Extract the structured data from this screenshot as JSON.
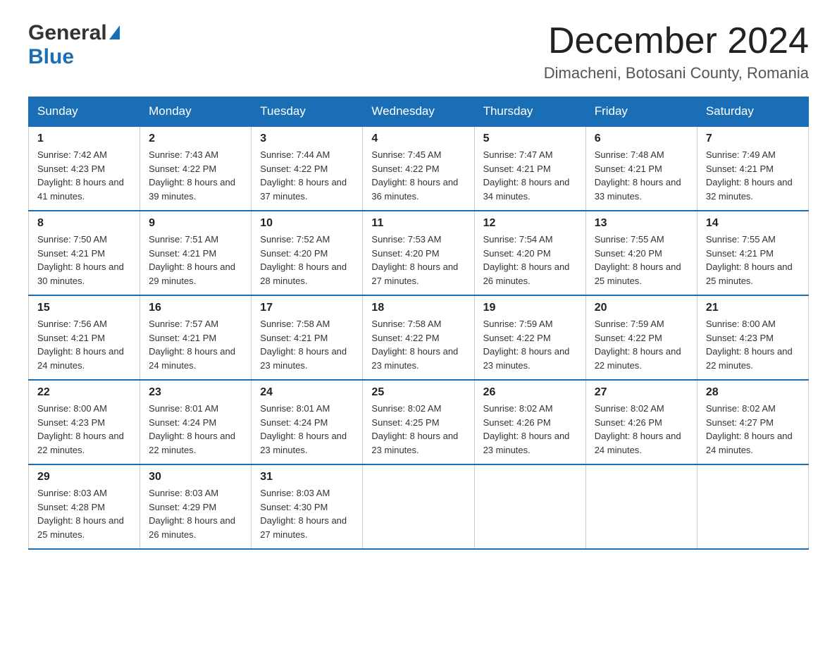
{
  "header": {
    "logo_general": "General",
    "logo_blue": "Blue",
    "month_title": "December 2024",
    "location": "Dimacheni, Botosani County, Romania"
  },
  "days_of_week": [
    "Sunday",
    "Monday",
    "Tuesday",
    "Wednesday",
    "Thursday",
    "Friday",
    "Saturday"
  ],
  "weeks": [
    [
      {
        "day": "1",
        "sunrise": "7:42 AM",
        "sunset": "4:23 PM",
        "daylight": "8 hours and 41 minutes."
      },
      {
        "day": "2",
        "sunrise": "7:43 AM",
        "sunset": "4:22 PM",
        "daylight": "8 hours and 39 minutes."
      },
      {
        "day": "3",
        "sunrise": "7:44 AM",
        "sunset": "4:22 PM",
        "daylight": "8 hours and 37 minutes."
      },
      {
        "day": "4",
        "sunrise": "7:45 AM",
        "sunset": "4:22 PM",
        "daylight": "8 hours and 36 minutes."
      },
      {
        "day": "5",
        "sunrise": "7:47 AM",
        "sunset": "4:21 PM",
        "daylight": "8 hours and 34 minutes."
      },
      {
        "day": "6",
        "sunrise": "7:48 AM",
        "sunset": "4:21 PM",
        "daylight": "8 hours and 33 minutes."
      },
      {
        "day": "7",
        "sunrise": "7:49 AM",
        "sunset": "4:21 PM",
        "daylight": "8 hours and 32 minutes."
      }
    ],
    [
      {
        "day": "8",
        "sunrise": "7:50 AM",
        "sunset": "4:21 PM",
        "daylight": "8 hours and 30 minutes."
      },
      {
        "day": "9",
        "sunrise": "7:51 AM",
        "sunset": "4:21 PM",
        "daylight": "8 hours and 29 minutes."
      },
      {
        "day": "10",
        "sunrise": "7:52 AM",
        "sunset": "4:20 PM",
        "daylight": "8 hours and 28 minutes."
      },
      {
        "day": "11",
        "sunrise": "7:53 AM",
        "sunset": "4:20 PM",
        "daylight": "8 hours and 27 minutes."
      },
      {
        "day": "12",
        "sunrise": "7:54 AM",
        "sunset": "4:20 PM",
        "daylight": "8 hours and 26 minutes."
      },
      {
        "day": "13",
        "sunrise": "7:55 AM",
        "sunset": "4:20 PM",
        "daylight": "8 hours and 25 minutes."
      },
      {
        "day": "14",
        "sunrise": "7:55 AM",
        "sunset": "4:21 PM",
        "daylight": "8 hours and 25 minutes."
      }
    ],
    [
      {
        "day": "15",
        "sunrise": "7:56 AM",
        "sunset": "4:21 PM",
        "daylight": "8 hours and 24 minutes."
      },
      {
        "day": "16",
        "sunrise": "7:57 AM",
        "sunset": "4:21 PM",
        "daylight": "8 hours and 24 minutes."
      },
      {
        "day": "17",
        "sunrise": "7:58 AM",
        "sunset": "4:21 PM",
        "daylight": "8 hours and 23 minutes."
      },
      {
        "day": "18",
        "sunrise": "7:58 AM",
        "sunset": "4:22 PM",
        "daylight": "8 hours and 23 minutes."
      },
      {
        "day": "19",
        "sunrise": "7:59 AM",
        "sunset": "4:22 PM",
        "daylight": "8 hours and 23 minutes."
      },
      {
        "day": "20",
        "sunrise": "7:59 AM",
        "sunset": "4:22 PM",
        "daylight": "8 hours and 22 minutes."
      },
      {
        "day": "21",
        "sunrise": "8:00 AM",
        "sunset": "4:23 PM",
        "daylight": "8 hours and 22 minutes."
      }
    ],
    [
      {
        "day": "22",
        "sunrise": "8:00 AM",
        "sunset": "4:23 PM",
        "daylight": "8 hours and 22 minutes."
      },
      {
        "day": "23",
        "sunrise": "8:01 AM",
        "sunset": "4:24 PM",
        "daylight": "8 hours and 22 minutes."
      },
      {
        "day": "24",
        "sunrise": "8:01 AM",
        "sunset": "4:24 PM",
        "daylight": "8 hours and 23 minutes."
      },
      {
        "day": "25",
        "sunrise": "8:02 AM",
        "sunset": "4:25 PM",
        "daylight": "8 hours and 23 minutes."
      },
      {
        "day": "26",
        "sunrise": "8:02 AM",
        "sunset": "4:26 PM",
        "daylight": "8 hours and 23 minutes."
      },
      {
        "day": "27",
        "sunrise": "8:02 AM",
        "sunset": "4:26 PM",
        "daylight": "8 hours and 24 minutes."
      },
      {
        "day": "28",
        "sunrise": "8:02 AM",
        "sunset": "4:27 PM",
        "daylight": "8 hours and 24 minutes."
      }
    ],
    [
      {
        "day": "29",
        "sunrise": "8:03 AM",
        "sunset": "4:28 PM",
        "daylight": "8 hours and 25 minutes."
      },
      {
        "day": "30",
        "sunrise": "8:03 AM",
        "sunset": "4:29 PM",
        "daylight": "8 hours and 26 minutes."
      },
      {
        "day": "31",
        "sunrise": "8:03 AM",
        "sunset": "4:30 PM",
        "daylight": "8 hours and 27 minutes."
      },
      null,
      null,
      null,
      null
    ]
  ],
  "labels": {
    "sunrise": "Sunrise:",
    "sunset": "Sunset:",
    "daylight": "Daylight:"
  }
}
